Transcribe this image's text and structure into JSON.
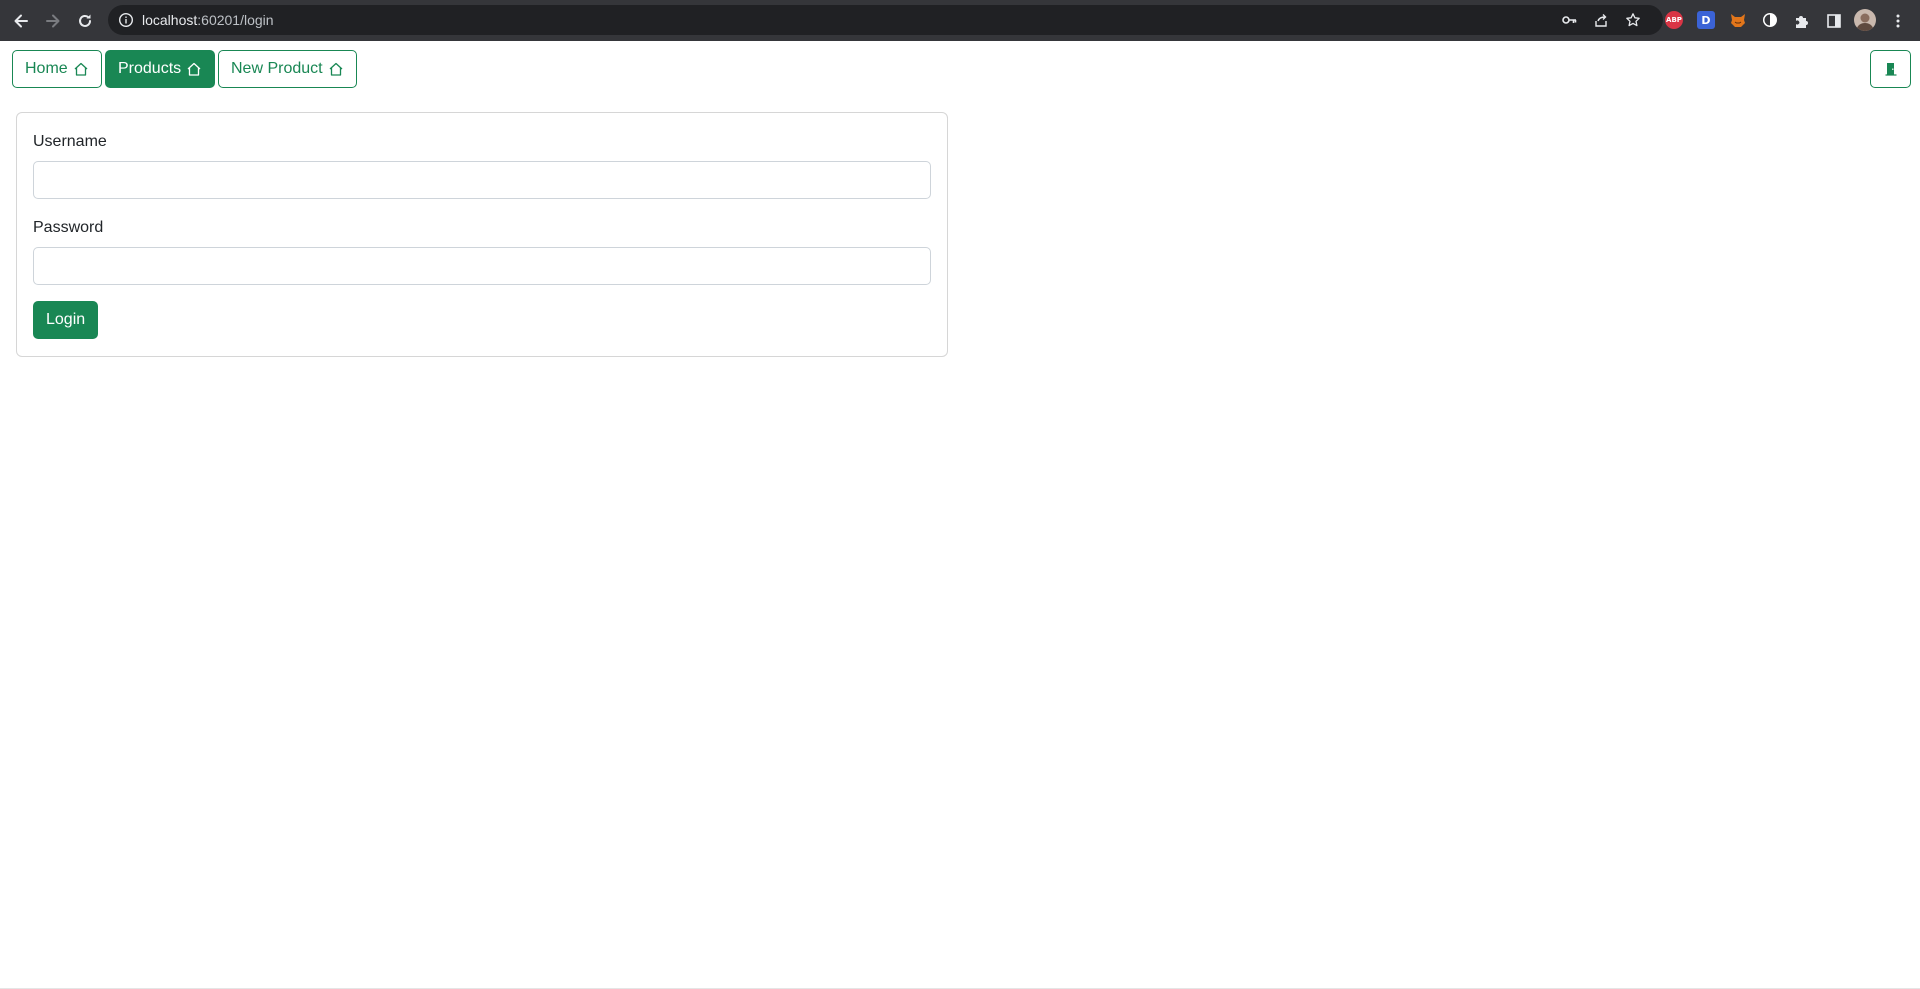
{
  "browser": {
    "url_host": "localhost",
    "url_rest": ":60201/login",
    "icons": {
      "back": "arrow-left-icon",
      "forward": "arrow-right-icon",
      "reload": "reload-icon",
      "info": "info-icon",
      "key": "key-icon",
      "share": "share-icon",
      "bookmark": "star-icon",
      "extensions": "puzzle-icon",
      "side_panel": "side-panel-icon",
      "menu": "kebab-menu-icon"
    },
    "extensions": {
      "abp_label": "ABP",
      "d_label": "D"
    }
  },
  "nav": {
    "home_label": "Home",
    "products_label": "Products",
    "new_product_label": "New Product",
    "accent_color": "#198754"
  },
  "login_form": {
    "username_label": "Username",
    "username_value": "",
    "password_label": "Password",
    "password_value": "",
    "submit_label": "Login"
  }
}
